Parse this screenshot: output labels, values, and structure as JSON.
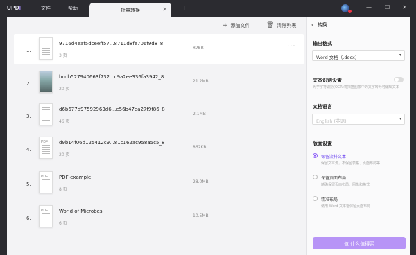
{
  "app": {
    "logo_main": "UPD",
    "logo_accent": "F"
  },
  "menu": {
    "file": "文件",
    "help": "帮助"
  },
  "tab": {
    "label": "批量转换",
    "close": "✕"
  },
  "toolbar": {
    "add_files": "添加文件",
    "clear_list": "清除列表"
  },
  "files": [
    {
      "index": "1.",
      "name": "9716d4eaf5dceeff57...8711d8fe706f9d8_8",
      "pages": "3 页",
      "size": "82KB",
      "thumb": "doc"
    },
    {
      "index": "2.",
      "name": "bcdb527940663f732...c9a2ee336fa3942_8",
      "pages": "20 页",
      "size": "21.2MB",
      "thumb": "dark"
    },
    {
      "index": "3.",
      "name": "d6b677d97592963d6...e56b47ea27f9f86_8",
      "pages": "46 页",
      "size": "2.1MB",
      "thumb": "doc"
    },
    {
      "index": "4.",
      "name": "d9b14f06d125412c9...81c162ac958a5c5_8",
      "pages": "20 页",
      "size": "862KB",
      "thumb": "pdf"
    },
    {
      "index": "5.",
      "name": "PDF-example",
      "pages": "8 页",
      "size": "28.0MB",
      "thumb": "pdf"
    },
    {
      "index": "6.",
      "name": "World of Microbes",
      "pages": "6 页",
      "size": "10.5MB",
      "thumb": "pdf"
    }
  ],
  "more_label": "···",
  "panel": {
    "title": "转换",
    "output_format_label": "输出格式",
    "output_format_value": "Word 文档（.docx）",
    "ocr_label": "文本识别设置",
    "ocr_desc": "光学字符识别(OCR)将扫描图像中的文字转为可编辑文本",
    "doc_lang_label": "文档语言",
    "doc_lang_value": "English (英语)",
    "layout_label": "版面设置",
    "options": [
      {
        "label": "保留流排文本",
        "desc": "保留文本流，不保留表格、页面布局等",
        "selected": true
      },
      {
        "label": "保留页面布局",
        "desc": "精确保留页面布局、图像和格式",
        "selected": false
      },
      {
        "label": "精准布局",
        "desc": "使用 Word 文本框保留页面布局",
        "selected": false
      }
    ],
    "convert_label": "转换"
  },
  "watermark": "值 什么值得买"
}
